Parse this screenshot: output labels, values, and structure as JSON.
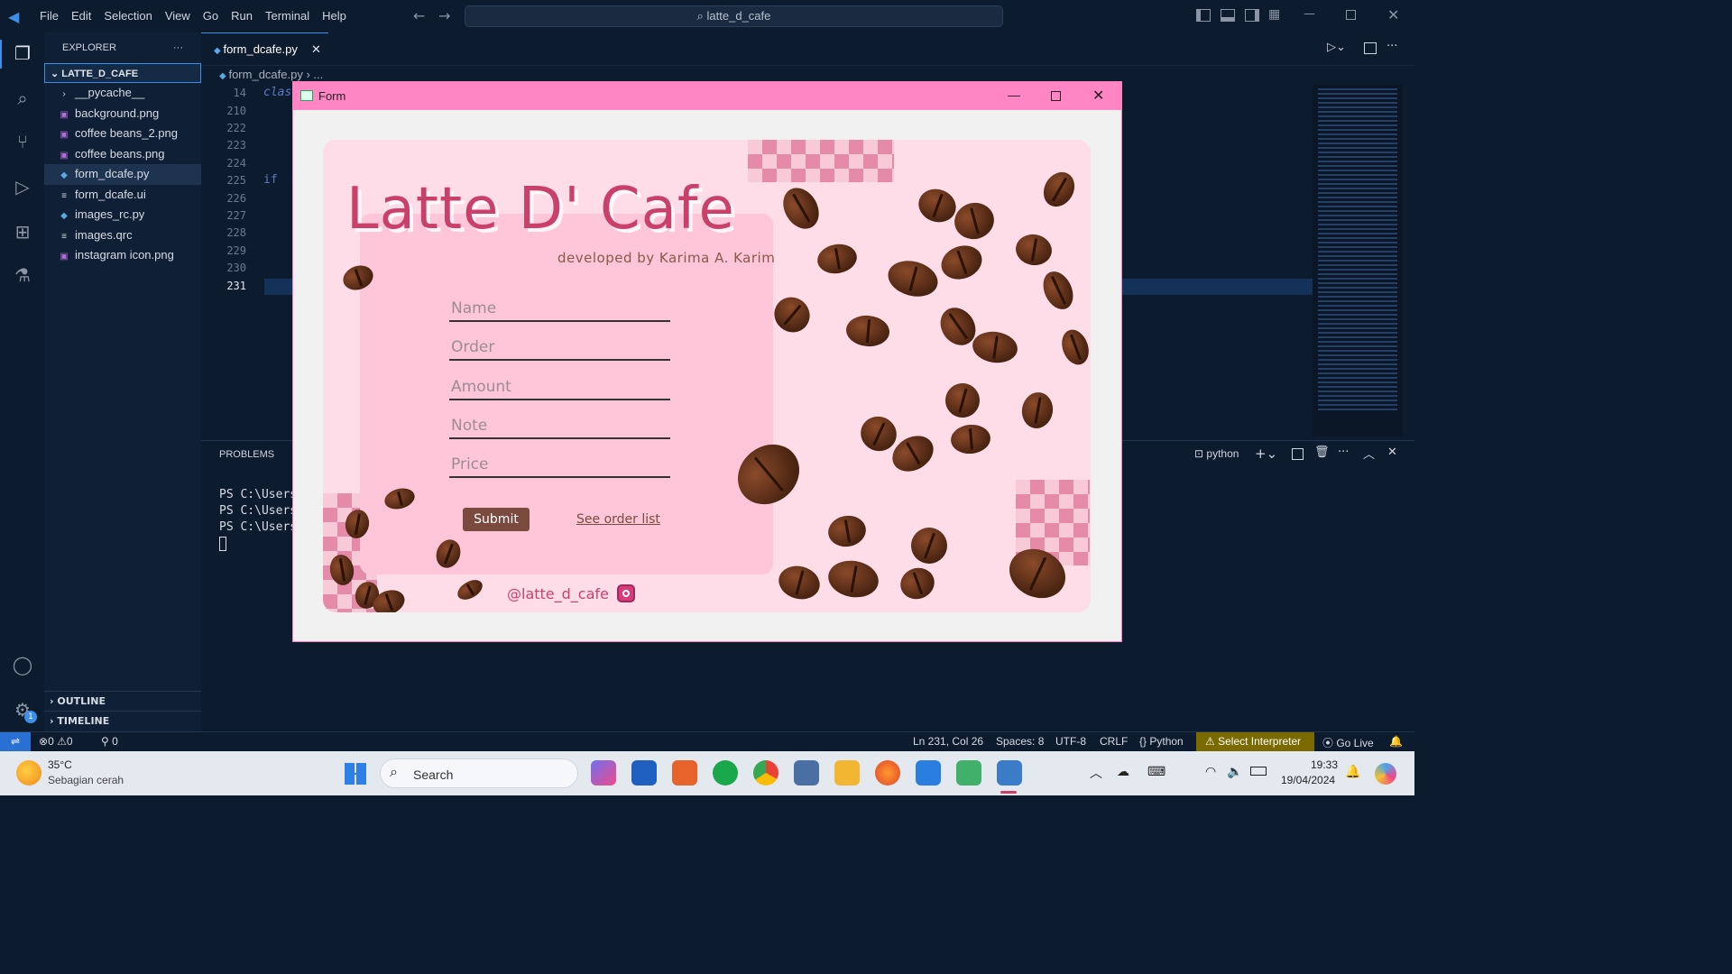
{
  "menu": [
    "File",
    "Edit",
    "Selection",
    "View",
    "Go",
    "Run",
    "Terminal",
    "Help"
  ],
  "search_text": "latte_d_cafe",
  "explorer": {
    "title": "EXPLORER",
    "folder": "LATTE_D_CAFE",
    "items": [
      "__pycache__",
      "background.png",
      "coffee beans_2.png",
      "coffee beans.png",
      "form_dcafe.py",
      "form_dcafe.ui",
      "images_rc.py",
      "images.qrc",
      "instagram icon.png"
    ],
    "outline": "OUTLINE",
    "timeline": "TIMELINE"
  },
  "tab": {
    "label": "form_dcafe.py"
  },
  "breadcrumb": "form_dcafe.py",
  "line_numbers": [
    "14",
    "210",
    "222",
    "223",
    "224",
    "225",
    "226",
    "227",
    "228",
    "229",
    "230",
    "231"
  ],
  "code": {
    "line14": "clas",
    "line225": "if"
  },
  "panel": {
    "tab": "PROBLEMS",
    "terminal_lines": [
      "PS C:\\Users",
      "PS C:\\Users",
      "PS C:\\Users"
    ],
    "shell": "python"
  },
  "status": {
    "errors": "0",
    "warnings": "0",
    "ports": "0",
    "position": "Ln 231, Col 26",
    "spaces": "Spaces: 8",
    "encoding": "UTF-8",
    "eol": "CRLF",
    "language": "Python",
    "interpreter": "Select Interpreter",
    "golive": "Go Live"
  },
  "form": {
    "window_title": "Form",
    "title": "Latte D' Cafe",
    "subtitle": "developed by Karima A. Karim",
    "placeholders": [
      "Name",
      "Order",
      "Amount",
      "Note",
      "Price"
    ],
    "submit": "Submit",
    "order_list": "See order list",
    "instagram": "@latte_d_cafe"
  },
  "taskbar": {
    "temperature": "35°C",
    "weather": "Sebagian cerah",
    "search": "Search",
    "time": "19:33",
    "date": "19/04/2024"
  },
  "colors": {
    "accent": "#ff85c5",
    "submit": "#7a4a3e",
    "brand_text": "#c9406b"
  }
}
